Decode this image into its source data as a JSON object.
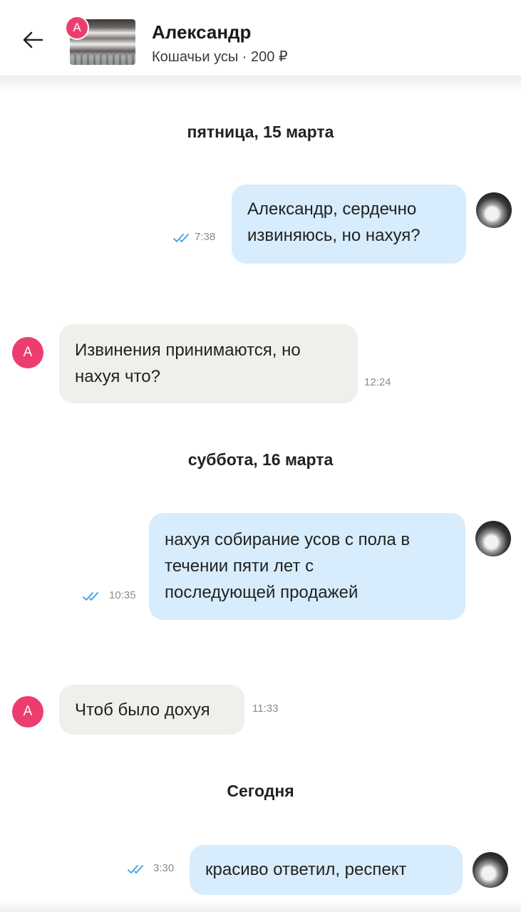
{
  "header": {
    "contact_name": "Александр",
    "listing": "Кошачьи усы · 200 ₽",
    "thumb_badge": "А",
    "back_icon": "arrow-left-icon"
  },
  "colors": {
    "outgoing_bubble": "#d7ecfc",
    "incoming_bubble": "#f1efec",
    "avatar_pink": "#ec3d6f",
    "read_tick": "#3aa0e6"
  },
  "dates": {
    "d1": "пятница, 15 марта",
    "d2": "суббота, 16 марта",
    "d3": "Сегодня"
  },
  "messages": [
    {
      "dir": "out",
      "lines": [
        "Александр, сердечно",
        "извиняюсь, но нахуя?"
      ],
      "time": "7:38",
      "read": true
    },
    {
      "dir": "in",
      "avatar": "А",
      "lines": [
        "Извинения принимаются, но",
        "нахуя что?"
      ],
      "time": "12:24"
    },
    {
      "dir": "out",
      "lines": [
        "нахуя собирание усов с пола в",
        "течении пяти лет с",
        "последующей продажей"
      ],
      "time": "10:35",
      "read": true
    },
    {
      "dir": "in",
      "avatar": "А",
      "lines": [
        "Чтоб было дохуя"
      ],
      "time": "11:33"
    },
    {
      "dir": "out",
      "lines": [
        "красиво ответил, респект"
      ],
      "time": "3:30",
      "read": true
    }
  ]
}
